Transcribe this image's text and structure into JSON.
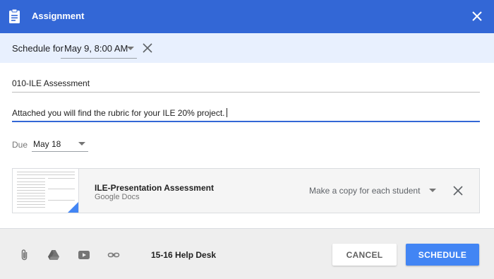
{
  "header": {
    "title": "Assignment"
  },
  "schedule": {
    "label": "Schedule for",
    "value": "May 9, 8:00 AM"
  },
  "form": {
    "title_value": "010-ILE Assessment",
    "instructions_value": "Attached you will find the rubric for your ILE 20% project."
  },
  "due": {
    "label": "Due",
    "value": "May 18"
  },
  "attachment": {
    "name": "ILE-Presentation Assessment",
    "type": "Google Docs",
    "share_option": "Make a copy for each student"
  },
  "footer": {
    "topic": "15-16 Help Desk",
    "cancel_label": "CANCEL",
    "schedule_label": "SCHEDULE",
    "icons": [
      "paperclip-icon",
      "google-drive-icon",
      "youtube-icon",
      "link-icon"
    ]
  },
  "colors": {
    "header_bg": "#3367d6",
    "schedule_bar_bg": "#e8f0fe",
    "primary_button": "#4285f4"
  }
}
